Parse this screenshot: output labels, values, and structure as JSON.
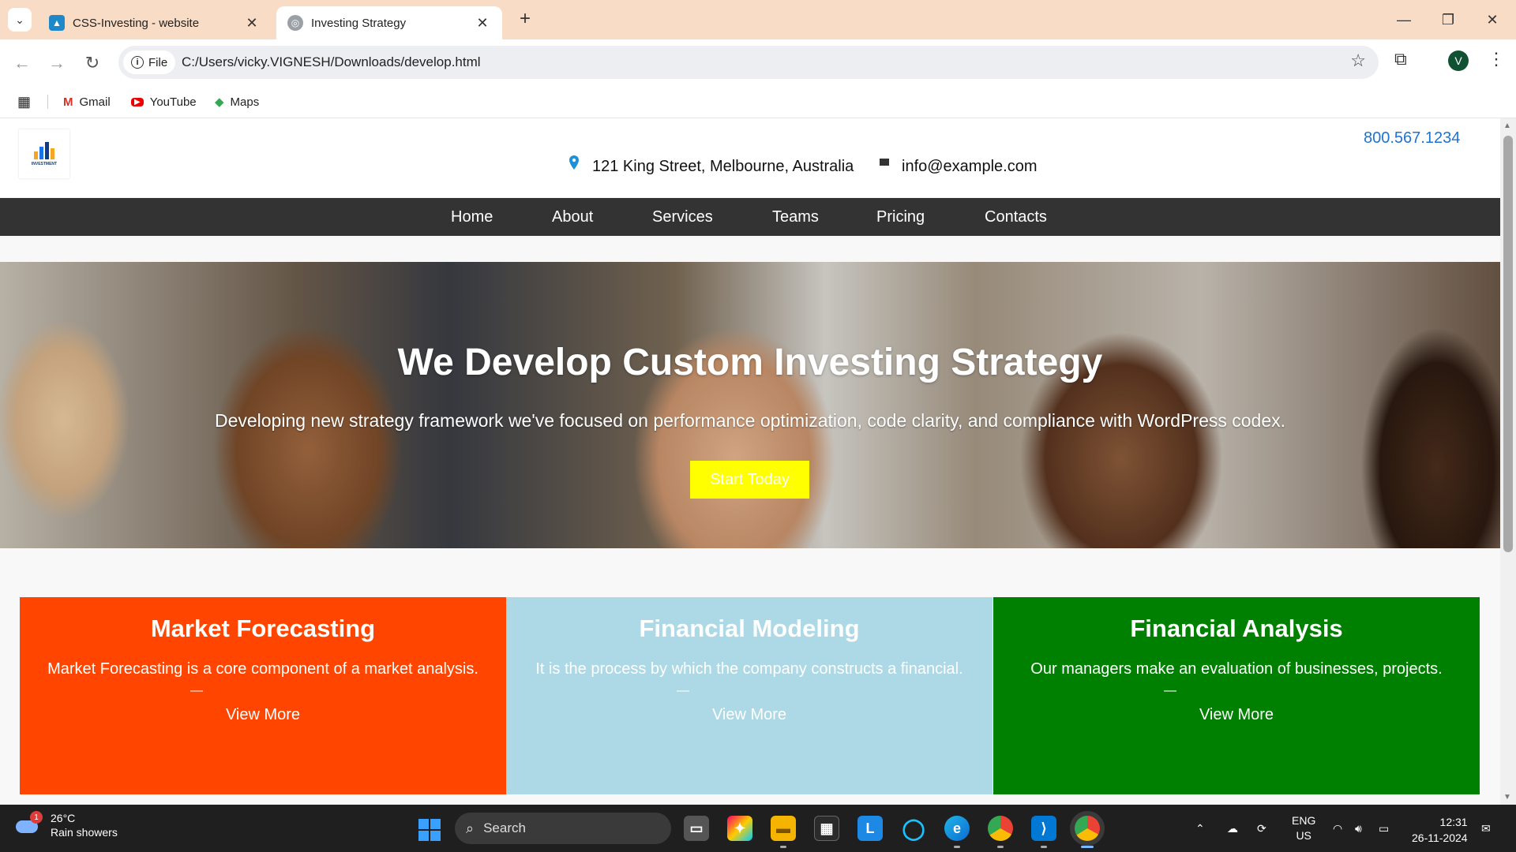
{
  "browser": {
    "tabs": [
      {
        "title": "CSS-Investing - website",
        "active": false
      },
      {
        "title": "Investing Strategy",
        "active": true
      }
    ],
    "omnibox": {
      "chip_label": "File",
      "url": "C:/Users/vicky.VIGNESH/Downloads/develop.html"
    },
    "profile_initial": "V",
    "bookmarks": [
      "Gmail",
      "YouTube",
      "Maps"
    ]
  },
  "site": {
    "phone": "800.567.1234",
    "address": "121 King Street, Melbourne, Australia",
    "email": "info@example.com",
    "nav": [
      "Home",
      "About",
      "Services",
      "Teams",
      "Pricing",
      "Contacts"
    ],
    "hero": {
      "title": "We Develop Custom Investing Strategy",
      "subtitle": "Developing new strategy framework we've focused on performance optimization, code clarity, and compliance with WordPress codex.",
      "button": "Start Today"
    },
    "cards": [
      {
        "title": "Market Forecasting",
        "text": "Market Forecasting is a core component of a market analysis.",
        "dash": "—",
        "link": "View More",
        "color": "#ff4500"
      },
      {
        "title": "Financial Modeling",
        "text": "It is the process by which the company constructs a financial.",
        "dash": "—",
        "link": "View More",
        "color": "#add8e6"
      },
      {
        "title": "Financial Analysis",
        "text": "Our managers make an evaluation of businesses, projects.",
        "dash": "—",
        "link": "View More",
        "color": "#008000"
      }
    ]
  },
  "taskbar": {
    "weather_badge": "1",
    "temperature": "26°C",
    "weather": "Rain showers",
    "search_placeholder": "Search",
    "language": "ENG",
    "region": "US",
    "time": "12:31",
    "date": "26-11-2024"
  }
}
